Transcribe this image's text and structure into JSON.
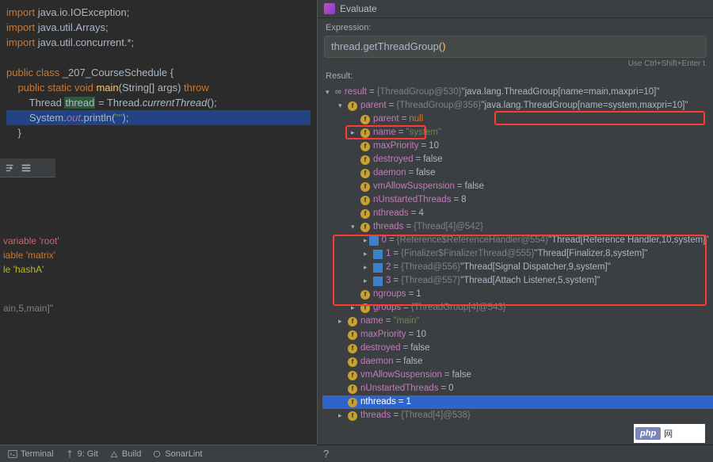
{
  "code": {
    "imports": [
      "import java.io.IOException;",
      "import java.util.Arrays;",
      "import java.util.concurrent.*;"
    ],
    "class_decl_prefix": "public class ",
    "class_name": "_207_CourseSchedule",
    "class_decl_suffix": " {",
    "main_sig": "public static void main(String[] args) throw",
    "thread_line": {
      "type": "Thread ",
      "var": "thread",
      "assign": " = Thread.",
      "call": "currentThread",
      "end": "();"
    },
    "println_line": {
      "prefix": "System.",
      "out": "out",
      "dot": ".println(",
      "arg": "\"\"",
      "end": ");"
    },
    "close": "}"
  },
  "gutter": {
    "icon_run": "run-icon",
    "icon_list": "list-icon"
  },
  "errors": {
    "e1": "variable 'root'",
    "e2": "iable 'matrix'",
    "e3": "le 'hashA'",
    "info": "ain,5,main]\""
  },
  "eval": {
    "title": "Evaluate",
    "expr_label": "Expression:",
    "expr_text": "thread.getThreadGroup",
    "expr_paren": "()",
    "hint": "Use Ctrl+Shift+Enter t",
    "result_label": "Result:"
  },
  "tree": {
    "result": {
      "name": "result",
      "ref": "{ThreadGroup@530}",
      "val": "\"java.lang.ThreadGroup[name=main,maxpri=10]\""
    },
    "parent": {
      "name": "parent",
      "ref": "{ThreadGroup@356}",
      "val": "\"java.lang.ThreadGroup[name=system,maxpri=10]\""
    },
    "parent_null": {
      "name": "parent",
      "val": "null"
    },
    "name_sys": {
      "name": "name",
      "val": "\"system\""
    },
    "maxPriority": {
      "name": "maxPriority",
      "val": "10"
    },
    "destroyed": {
      "name": "destroyed",
      "val": "false"
    },
    "daemon": {
      "name": "daemon",
      "val": "false"
    },
    "vmAllow": {
      "name": "vmAllowSuspension",
      "val": "false"
    },
    "nUnstarted": {
      "name": "nUnstartedThreads",
      "val": "8"
    },
    "nthreads": {
      "name": "nthreads",
      "val": "4"
    },
    "threads": {
      "name": "threads",
      "ref": "{Thread[4]@542}"
    },
    "t0": {
      "idx": "0",
      "ref": "{Reference$ReferenceHandler@554}",
      "val": "\"Thread[Reference Handler,10,system]\""
    },
    "t1": {
      "idx": "1",
      "ref": "{Finalizer$FinalizerThread@555}",
      "val": "\"Thread[Finalizer,8,system]\""
    },
    "t2": {
      "idx": "2",
      "ref": "{Thread@556}",
      "val": "\"Thread[Signal Dispatcher,9,system]\""
    },
    "t3": {
      "idx": "3",
      "ref": "{Thread@557}",
      "val": "\"Thread[Attach Listener,5,system]\""
    },
    "ngroups": {
      "name": "ngroups",
      "val": "1"
    },
    "groups": {
      "name": "groups",
      "ref": "{ThreadGroup[4]@543}"
    },
    "name_main": {
      "name": "name",
      "val": "\"main\""
    },
    "maxPriority2": {
      "name": "maxPriority",
      "val": "10"
    },
    "destroyed2": {
      "name": "destroyed",
      "val": "false"
    },
    "daemon2": {
      "name": "daemon",
      "val": "false"
    },
    "vmAllow2": {
      "name": "vmAllowSuspension",
      "val": "false"
    },
    "nUnstarted2": {
      "name": "nUnstartedThreads",
      "val": "0"
    },
    "nthreads2": {
      "name": "nthreads",
      "val": "1"
    },
    "threads2": {
      "name": "threads",
      "ref": "{Thread[4]@538}"
    }
  },
  "bottom": {
    "terminal": "Terminal",
    "git": "9: Git",
    "build": "Build",
    "sonar": "SonarLint"
  },
  "logo": {
    "php": "php",
    "cn": "网"
  }
}
